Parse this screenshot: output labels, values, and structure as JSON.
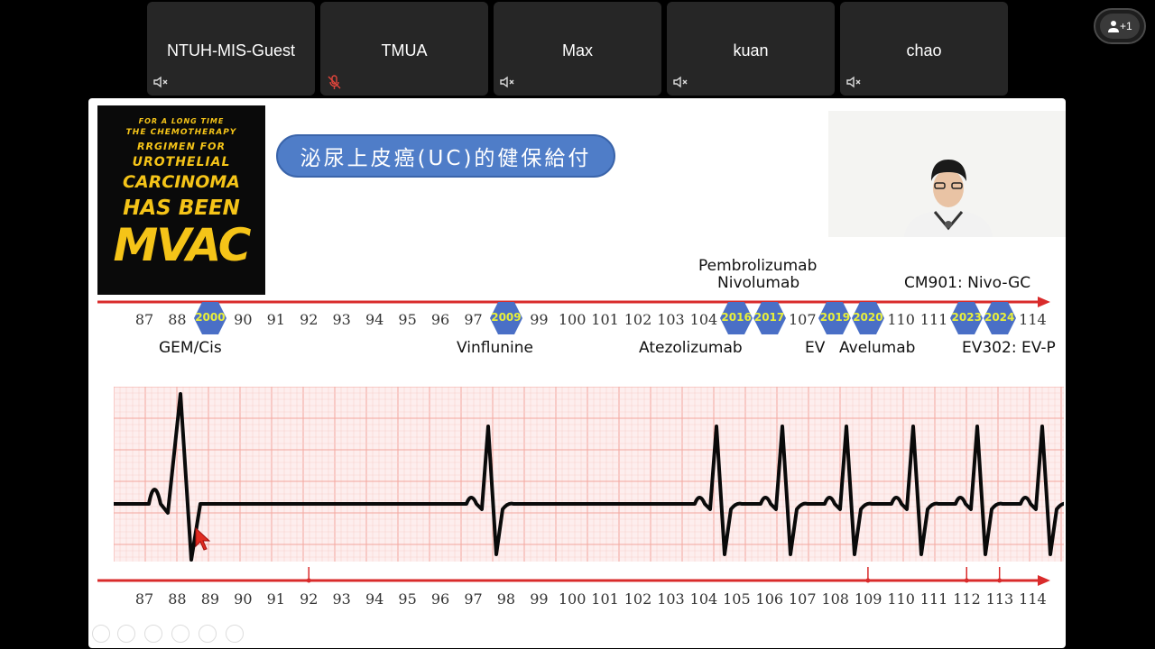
{
  "participants": [
    {
      "name": "NTUH-MIS-Guest",
      "mic": "muted-speaker"
    },
    {
      "name": "TMUA",
      "mic": "muted-mic"
    },
    {
      "name": "Max",
      "mic": "muted-speaker"
    },
    {
      "name": "kuan",
      "mic": "muted-speaker"
    },
    {
      "name": "chao",
      "mic": "muted-speaker"
    }
  ],
  "more_participants": {
    "count": "+1"
  },
  "slide": {
    "poster_lines": [
      "FOR A LONG TIME",
      "THE CHEMOTHERAPY",
      "RRGIMEN FOR",
      "UROTHELIAL",
      "CARCINOMA",
      "HAS BEEN",
      "MVAC"
    ],
    "title": "泌尿上皮癌(UC)的健保給付",
    "timeline_years": [
      "87",
      "88",
      "89",
      "90",
      "91",
      "92",
      "93",
      "94",
      "95",
      "96",
      "97",
      "98",
      "99",
      "100",
      "101",
      "102",
      "103",
      "104",
      "105",
      "106",
      "107",
      "108",
      "109",
      "110",
      "111",
      "112",
      "113",
      "114"
    ],
    "milestones": [
      {
        "year": "2000"
      },
      {
        "year": "2009"
      },
      {
        "year": "2016"
      },
      {
        "year": "2017"
      },
      {
        "year": "2019"
      },
      {
        "year": "2020"
      },
      {
        "year": "2023"
      },
      {
        "year": "2024"
      }
    ],
    "drugs_above": [
      "Pembrolizumab",
      "Nivolumab",
      "CM901: Nivo-GC"
    ],
    "drugs_below": [
      "GEM/Cis",
      "Vinflunine",
      "Atezolizumab",
      "EV",
      "Avelumab",
      "EV302: EV-P"
    ]
  },
  "colors": {
    "accent": "#4f7dc8",
    "timeline": "#d92b2b",
    "hex": "#4a6fc6",
    "hex_text": "#e8ef3a",
    "ecg_grid": "#f6a8a0"
  }
}
